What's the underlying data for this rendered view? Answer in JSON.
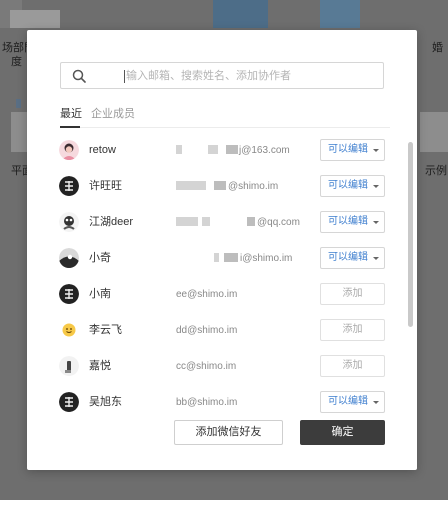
{
  "background": {
    "left_text_1": "场部門",
    "left_text_2": "度",
    "left_text_3": "平面",
    "right_text_1": "婚",
    "right_text_2": "示例"
  },
  "search": {
    "placeholder": "输入邮箱、搜索姓名、添加协作者",
    "value": ""
  },
  "tabs": {
    "recent": "最近",
    "members": "企业成员"
  },
  "members": [
    {
      "name": "retow",
      "email": "j@163.com",
      "action": "permission",
      "action_label": "可以编辑"
    },
    {
      "name": "许旺旺",
      "email": "@shimo.im",
      "action": "permission",
      "action_label": "可以编辑"
    },
    {
      "name": "江湖deer",
      "email": "@qq.com",
      "action": "permission",
      "action_label": "可以编辑"
    },
    {
      "name": "小奇",
      "email": "i@shimo.im",
      "action": "permission",
      "action_label": "可以编辑"
    },
    {
      "name": "小南",
      "email": "ee@shimo.im",
      "action": "add",
      "action_label": "添加"
    },
    {
      "name": "李云飞",
      "email": "dd@shimo.im",
      "action": "add",
      "action_label": "添加"
    },
    {
      "name": "嘉悦",
      "email": "cc@shimo.im",
      "action": "add",
      "action_label": "添加"
    },
    {
      "name": "吴旭东",
      "email": "bb@shimo.im",
      "action": "permission",
      "action_label": "可以编辑"
    }
  ],
  "footer": {
    "wechat_label": "添加微信好友",
    "confirm_label": "确定"
  },
  "colors": {
    "accent_blue": "#3f7fcf",
    "primary_button": "#3c3c3c",
    "overlay": "#6e6e6e"
  }
}
